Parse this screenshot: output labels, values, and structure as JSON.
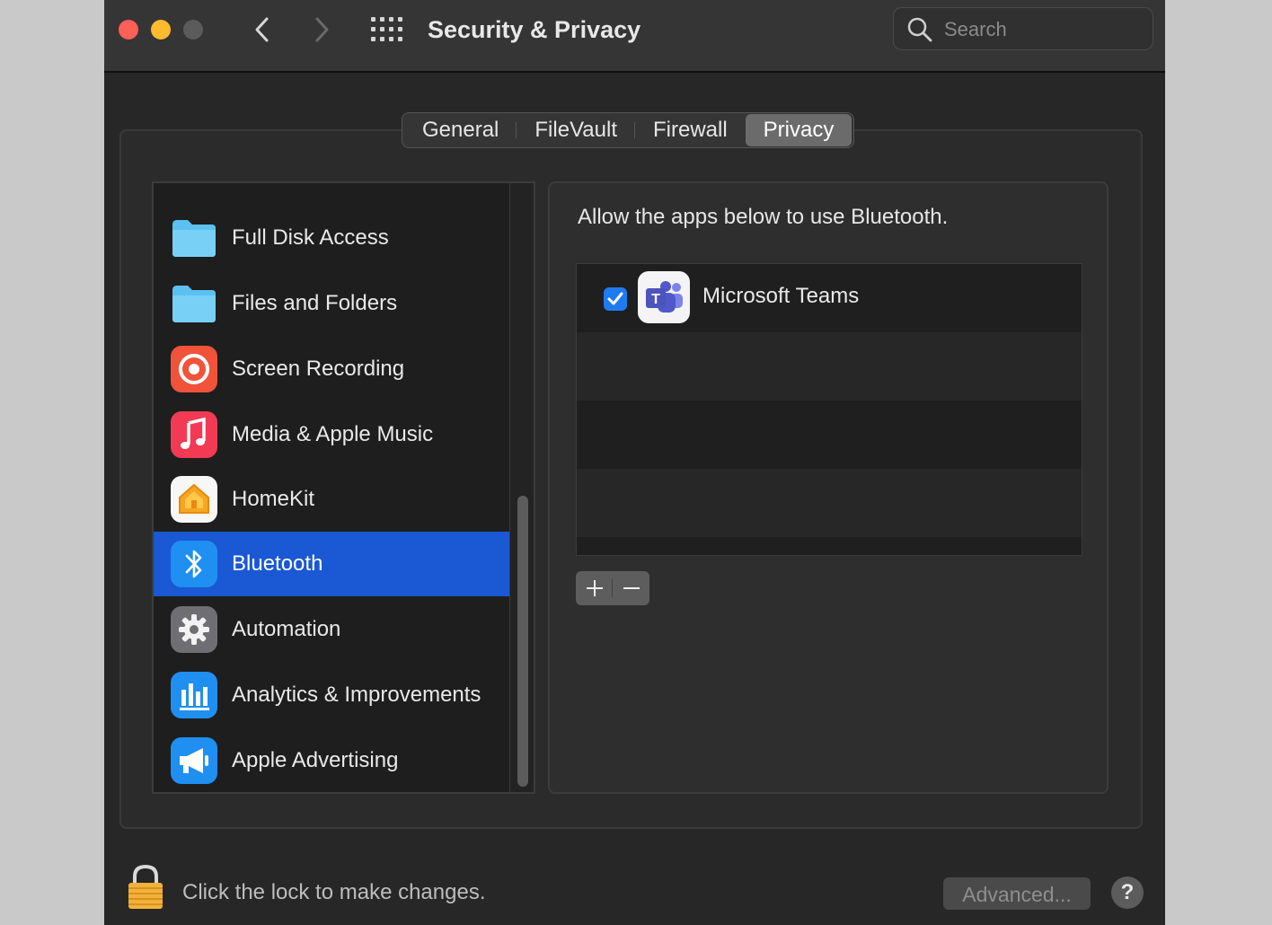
{
  "window": {
    "title": "Security & Privacy"
  },
  "search": {
    "placeholder": "Search"
  },
  "tabs": [
    {
      "label": "General"
    },
    {
      "label": "FileVault"
    },
    {
      "label": "Firewall"
    },
    {
      "label": "Privacy",
      "active": true
    }
  ],
  "sidebar": {
    "items": [
      {
        "label": "Full Disk Access",
        "icon": "folder-icon"
      },
      {
        "label": "Files and Folders",
        "icon": "folder-icon"
      },
      {
        "label": "Screen Recording",
        "icon": "screen-recording-icon"
      },
      {
        "label": "Media & Apple Music",
        "icon": "music-icon"
      },
      {
        "label": "HomeKit",
        "icon": "home-icon"
      },
      {
        "label": "Bluetooth",
        "icon": "bluetooth-icon",
        "selected": true
      },
      {
        "label": "Automation",
        "icon": "gear-icon"
      },
      {
        "label": "Analytics & Improvements",
        "icon": "analytics-icon"
      },
      {
        "label": "Apple Advertising",
        "icon": "megaphone-icon"
      }
    ]
  },
  "detail": {
    "description": "Allow the apps below to use Bluetooth.",
    "apps": [
      {
        "name": "Microsoft Teams",
        "checked": true,
        "icon": "teams-icon"
      }
    ]
  },
  "footer": {
    "lock_text": "Click the lock to make changes.",
    "advanced_label": "Advanced...",
    "help_label": "?"
  },
  "colors": {
    "selection": "#1a58d4",
    "checkbox": "#1f7bf2"
  }
}
